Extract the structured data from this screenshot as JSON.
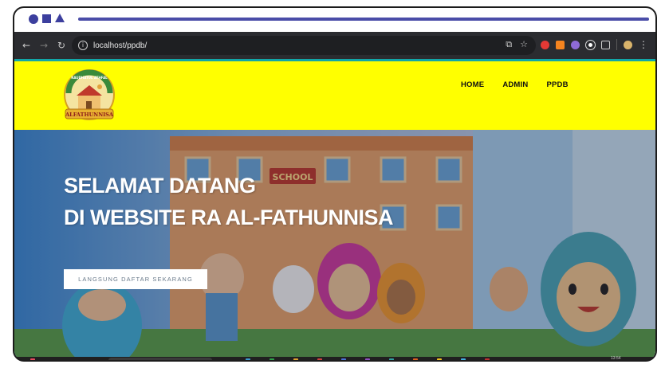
{
  "browser": {
    "url": "localhost/ppdb/",
    "nav_icons": [
      "back-icon",
      "forward-icon",
      "reload-icon"
    ],
    "colors": {
      "frame_accent": "#3c3f9e",
      "toolbar": "#2b2c30",
      "omnibox": "#1e1f22"
    }
  },
  "site": {
    "logo_name": "ALFATHUNNISA",
    "logo_arc_text": "RAUDHATUL ATHFAL",
    "nav": [
      "HOME",
      "ADMIN",
      "PPDB"
    ],
    "hero": {
      "title_line1": "SELAMAT DATANG",
      "title_line2": "DI WEBSITE RA AL-FATHUNNISA",
      "cta_label": "LANGSUNG DAFTAR SEKARANG",
      "sign_text": "SCHOOL"
    },
    "colors": {
      "header": "#ffff00",
      "teal": "#12a6a8"
    }
  },
  "taskbar": {
    "clock": "13:54"
  }
}
